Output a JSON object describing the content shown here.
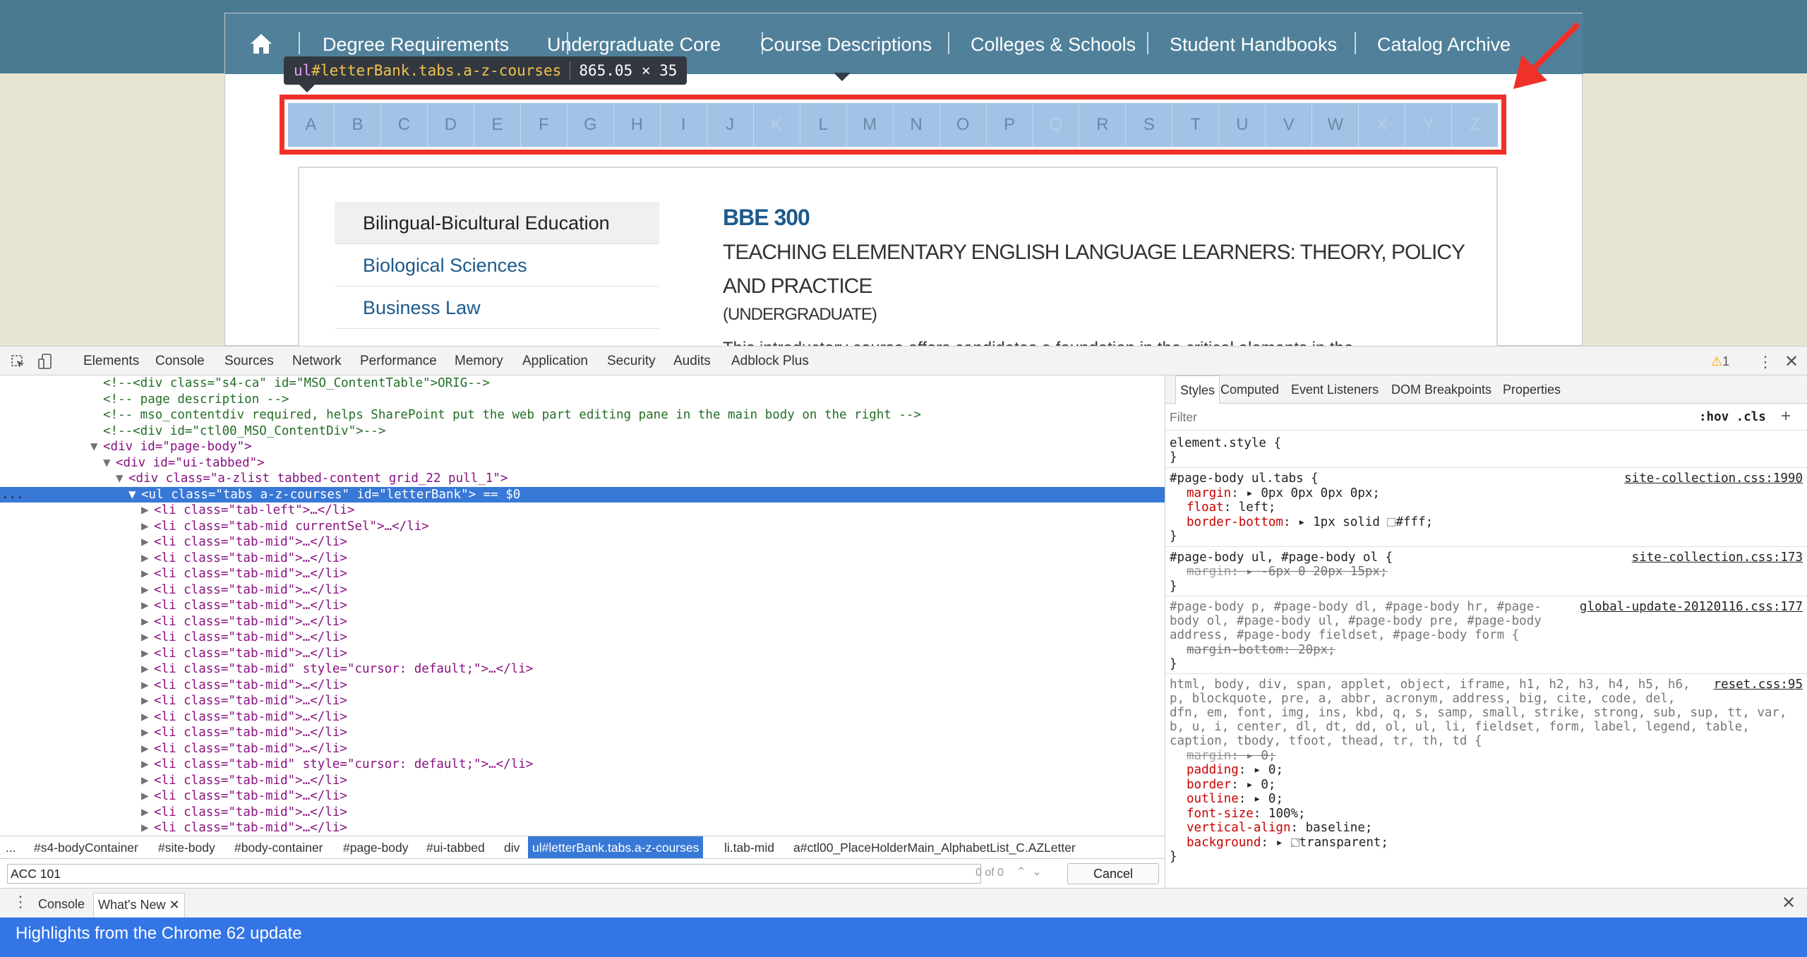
{
  "site_nav": {
    "items": [
      "Degree Requirements",
      "Undergraduate Core",
      "Course Descriptions",
      "Colleges & Schools",
      "Student Handbooks",
      "Catalog Archive"
    ]
  },
  "inspect_tooltip": {
    "tag": "ul",
    "selector": "#letterBank.tabs.a-z-courses",
    "size": "865.05 × 35"
  },
  "letters": [
    {
      "label": "A",
      "enabled": true
    },
    {
      "label": "B",
      "enabled": true
    },
    {
      "label": "C",
      "enabled": true
    },
    {
      "label": "D",
      "enabled": true
    },
    {
      "label": "E",
      "enabled": true
    },
    {
      "label": "F",
      "enabled": true
    },
    {
      "label": "G",
      "enabled": true
    },
    {
      "label": "H",
      "enabled": true
    },
    {
      "label": "I",
      "enabled": true
    },
    {
      "label": "J",
      "enabled": true
    },
    {
      "label": "K",
      "enabled": false
    },
    {
      "label": "L",
      "enabled": true
    },
    {
      "label": "M",
      "enabled": true
    },
    {
      "label": "N",
      "enabled": true
    },
    {
      "label": "O",
      "enabled": true
    },
    {
      "label": "P",
      "enabled": true
    },
    {
      "label": "Q",
      "enabled": false
    },
    {
      "label": "R",
      "enabled": true
    },
    {
      "label": "S",
      "enabled": true
    },
    {
      "label": "T",
      "enabled": true
    },
    {
      "label": "U",
      "enabled": true
    },
    {
      "label": "V",
      "enabled": true
    },
    {
      "label": "W",
      "enabled": true
    },
    {
      "label": "X",
      "enabled": false
    },
    {
      "label": "Y",
      "enabled": false
    },
    {
      "label": "Z",
      "enabled": false
    }
  ],
  "subjects": [
    "Bilingual-Bicultural Education",
    "Biological Sciences",
    "Business Law"
  ],
  "course": {
    "code": "BBE 300",
    "title": "TEACHING ELEMENTARY ENGLISH LANGUAGE LEARNERS: THEORY, POLICY AND PRACTICE",
    "level": "(UNDERGRADUATE)",
    "description": "This introductory course offers candidates a foundation in the critical elements in the"
  },
  "devtools": {
    "tabs": [
      "Elements",
      "Console",
      "Sources",
      "Network",
      "Performance",
      "Memory",
      "Application",
      "Security",
      "Audits",
      "Adblock Plus"
    ],
    "active_tab": "Elements",
    "warning_count": "1",
    "styles_tabs": [
      "Styles",
      "Computed",
      "Event Listeners",
      "DOM Breakpoints",
      "Properties"
    ],
    "filter_placeholder": "Filter",
    "hov_cls": ":hov  .cls",
    "breadcrumbs": [
      "...",
      "#s4-bodyContainer",
      "#site-body",
      "#body-container",
      "#page-body",
      "#ui-tabbed",
      "div",
      "ul#letterBank.tabs.a-z-courses",
      "li.tab-mid",
      "a#ctl00_PlaceHolderMain_AlphabetList_C.AZLetter"
    ],
    "search_value": "ACC 101",
    "search_count": "0 of 0",
    "cancel_label": "Cancel",
    "drawer_tabs": [
      "Console",
      "What's New"
    ],
    "banner": "Highlights from the Chrome 62 update"
  },
  "dom_lines": [
    "<!--<div class=\"s4-ca\" id=\"MSO_ContentTable\">ORIG-->",
    "<!-- page description -->",
    "<!-- mso_contentdiv required, helps SharePoint put the web part editing pane in the main body on the right -->",
    "<!--<div id=\"ctl00_MSO_ContentDiv\">-->",
    "<div id=\"page-body\">",
    "<div id=\"ui-tabbed\">",
    "<div class=\"a-zlist tabbed-content grid_22 pull_1\">",
    "<ul class=\"tabs a-z-courses\" id=\"letterBank\"> == $0",
    "<li class=\"tab-left\">…</li>",
    "<li class=\"tab-mid currentSel\">…</li>",
    "<li class=\"tab-mid\">…</li>",
    "<li class=\"tab-mid\" style=\"cursor: default;\">…</li>"
  ],
  "css_rules": {
    "element_style": "element.style {",
    "r1_selector": "#page-body ul.tabs {",
    "r1_src": "site-collection.css:1990",
    "r1_margin": "0px 0px 0px 0px;",
    "r1_float": "left;",
    "r1_border": "1px solid ",
    "r1_border_color": "#fff;",
    "r2_selector": "#page-body ul, #page-body ol {",
    "r2_src": "site-collection.css:173",
    "r2_margin": "-6px 0 20px 15px;",
    "r3_sel1": "#page-body p, #page-body dl, #page-body hr, #page-",
    "r3_sel2": "body ol, #page-body ul, #page-body pre, #page-body",
    "r3_sel3": "address, #page-body fieldset, #page-body form {",
    "r3_src": "global-update-20120116.css:177",
    "r3_prop": "margin-bottom: 20px;",
    "r4_sel1": "html, body, div, span, applet, object, iframe, h1, h2, h3, h4, h5, h6,",
    "r4_sel2": "p, blockquote, pre, a, abbr, acronym, address, big, cite, code, del,",
    "r4_sel3": "dfn, em, font, img, ins, kbd, q, s, samp, small, strike, strong, sub, sup, tt, var,",
    "r4_sel4": "b, u, i, center, dl, dt, dd, ol, ul, li, fieldset, form, label, legend, table,",
    "r4_sel5": "caption, tbody, tfoot, thead, tr, th, td {",
    "r4_src": "reset.css:95",
    "r4_margin": "0;",
    "r4_padding": "0;",
    "r4_border": "0;",
    "r4_outline": "0;",
    "r4_fontsize": "100%;",
    "r4_valign": "baseline;",
    "r4_bg": "transparent;"
  }
}
